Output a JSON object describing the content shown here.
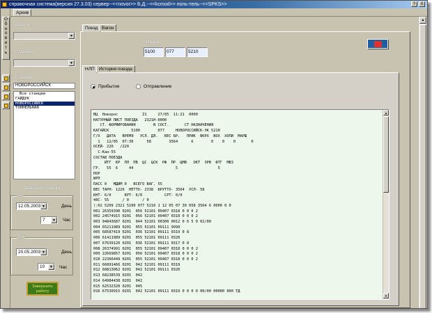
{
  "window": {
    "title": "справочная система(версия 27.3.03) сервер--<<novor>> Б.Д.--<<kcmod>> поль-тель--<<SPKS>>",
    "help_label": "?",
    "close_label": "X"
  },
  "menu": {
    "archive_tab": "Архив"
  },
  "toolbar": {
    "refresh_label": "О\nб\nн\nо\nв\nи\nт\nь"
  },
  "left": {
    "road_label": "Дорога",
    "branch_label": "Отделен.",
    "station_label": "Станция",
    "station_input": "НОВОРОССИЙСК",
    "station_list": [
      {
        "text": "Все станции",
        "sel": false,
        "ind": true
      },
      {
        "text": "ГАЙДУК",
        "sel": false,
        "ind": false
      },
      {
        "text": "НОВОРОССИЙСК",
        "sel": true,
        "ind": false
      },
      {
        "text": "ТОННЕЛЬНАЯ",
        "sel": false,
        "ind": false
      }
    ],
    "range_title": "Диапазон поиска",
    "from_title": "С",
    "to_title": "По",
    "from_date": "12.05.2003",
    "from_hour": "7",
    "to_date": "20.05.2003",
    "to_hour": "10",
    "day_label": "День",
    "hour_label": "Час",
    "exit_label": "Завершить работу"
  },
  "main": {
    "tabs": [
      "Поезд",
      "Вагон"
    ],
    "index_label": "Индекс",
    "index_values": [
      "5100",
      "077",
      "5210"
    ],
    "sub_tabs": [
      "НЛП",
      "История поезда"
    ],
    "radio_arrival": "Прибытие",
    "radio_departure": "Отправление",
    "memo_lines": [
      "ВЦ  Новорос           Z1     27/05  11:21  0000",
      "НАТУРНЫЙ ЛИСТ ПОЕЗДА   2321Н-0000",
      "   СТ. ФОРМИРОВАНИЯ        N СОСТ.       СТ НАЗНАЧЕНИЯ",
      "КАГАЙСК          5100        077     НОВОРОССИЙСК-ЭК 5210",
      "Г/Х   ДАТА   ВРЕМЯ   УСЛ. ДЛ.   ВЕС БР.   ПРИК  ВКРХ  ВОХ  ХОПИ  МАРШ",
      "  1   12/05  07:30      58        3564      6        0    0    0       0",
      "ОСЕЙ- 220   /220",
      "  С-Кан-55",
      "СОСТАВ ПОЕЗДА",
      "     ИТГ  КР  ПЛ  ПВ  ЦС  ЦСК  РФ  ПР  ЦМВ   ОКТ  ЗРВ  ФТГ  МВЗ",
      "ГР.   55  6     44                   5                  5",
      "ПОР",
      "ИРП",
      "ПАСС 0   МДИМ 0   ВСЕГО ВАГ. 55",
      "ВЕС ТАРН- 1226  НЕТТО- 2338  БРУТТО- 3564  УСЛ- 58",
      "КНТ- 6/0      КРТ- 6/0          СРТ- 0/0",
      "40С- 55      / 0      / 0",
      "(:02 5209 2321 5100 077 5210 1 12 05 07 30 058 3564 6 0000 0 0",
      "001 26359390 0201  056 52101 09407 0318 0 0 0 2",
      "002 24574915 0201  056 52101 09407 0318 0 0 0 2",
      "003 94843687 0201  044 52101 00300 0012 0 6 5 0 02/00",
      "004 65211989 0201  055 52101 09111 9999",
      "005 68587419 0201  036 52101 09111 0319 0 8",
      "006 61411989 0201  055 52101 09111 0320",
      "007 67639120 0201  036 52101 09111 0317 0 8",
      "008 26374991 0201  055 52101 09407 0318 0 0 0 2",
      "009 22669857 0201  056 52101 09407 0318 0 0 0 2",
      "010 22366449 0201  055 52101 09407 0318 0 0 0 2",
      "011 66891466 0201  042 52101 09111 0319",
      "012 60813062 0201  042 52101 09111 0320",
      "013 68238539 0201  042",
      "014 64984438 0201  042",
      "015 62532320 0201  045",
      "016 67530915 0201  042 52101 09111 0319 0 0 0 0 00/00 00000 000 ТД"
    ]
  }
}
